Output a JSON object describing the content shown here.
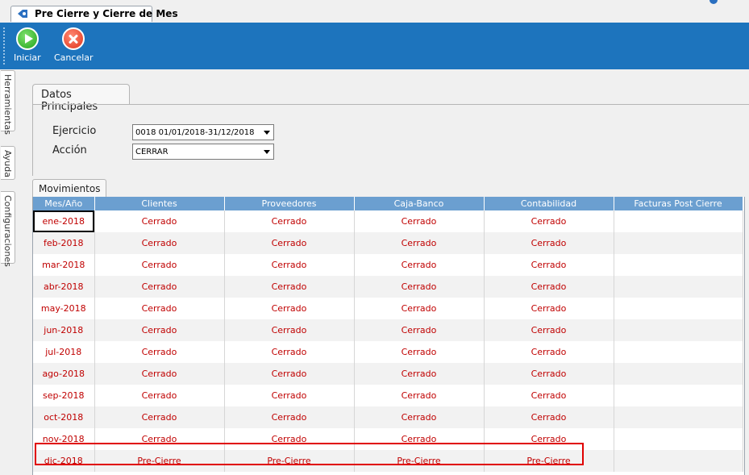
{
  "window": {
    "tab_title": "Pre Cierre y Cierre de Mes"
  },
  "toolbar": {
    "start_label": "Iniciar",
    "cancel_label": "Cancelar"
  },
  "side_tabs": [
    "Herramientas",
    "Ayuda",
    "Configuraciones"
  ],
  "main_panel": {
    "tab_label": "Datos Principales",
    "ejercicio_label": "Ejercicio",
    "ejercicio_value": "0018 01/01/2018-31/12/2018",
    "accion_label": "Acción",
    "accion_value": "CERRAR"
  },
  "movimientos": {
    "tab_label": "Movimientos",
    "columns": [
      "Mes/Año",
      "Clientes",
      "Proveedores",
      "Caja-Banco",
      "Contabilidad",
      "Facturas Post Cierre"
    ],
    "rows": [
      [
        "ene-2018",
        "Cerrado",
        "Cerrado",
        "Cerrado",
        "Cerrado",
        ""
      ],
      [
        "feb-2018",
        "Cerrado",
        "Cerrado",
        "Cerrado",
        "Cerrado",
        ""
      ],
      [
        "mar-2018",
        "Cerrado",
        "Cerrado",
        "Cerrado",
        "Cerrado",
        ""
      ],
      [
        "abr-2018",
        "Cerrado",
        "Cerrado",
        "Cerrado",
        "Cerrado",
        ""
      ],
      [
        "may-2018",
        "Cerrado",
        "Cerrado",
        "Cerrado",
        "Cerrado",
        ""
      ],
      [
        "jun-2018",
        "Cerrado",
        "Cerrado",
        "Cerrado",
        "Cerrado",
        ""
      ],
      [
        "jul-2018",
        "Cerrado",
        "Cerrado",
        "Cerrado",
        "Cerrado",
        ""
      ],
      [
        "ago-2018",
        "Cerrado",
        "Cerrado",
        "Cerrado",
        "Cerrado",
        ""
      ],
      [
        "sep-2018",
        "Cerrado",
        "Cerrado",
        "Cerrado",
        "Cerrado",
        ""
      ],
      [
        "oct-2018",
        "Cerrado",
        "Cerrado",
        "Cerrado",
        "Cerrado",
        ""
      ],
      [
        "nov-2018",
        "Cerrado",
        "Cerrado",
        "Cerrado",
        "Cerrado",
        ""
      ],
      [
        "dic-2018",
        "Pre-Cierre",
        "Pre-Cierre",
        "Pre-Cierre",
        "Pre-Cierre",
        ""
      ]
    ]
  },
  "colors": {
    "ribbon": "#1d74bd",
    "header": "#6b9fd0",
    "status_text": "#c00000",
    "highlight": "#e00000"
  },
  "icons": {
    "start": "play-circle-icon",
    "cancel": "x-circle-icon",
    "tab": "flag-icon"
  }
}
